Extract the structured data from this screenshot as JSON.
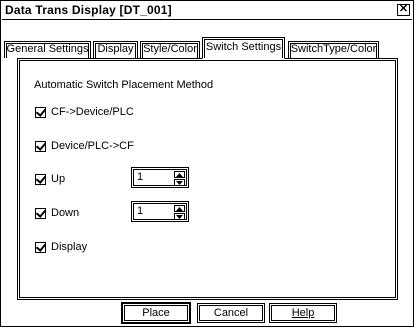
{
  "window": {
    "title": "Data Trans Display [DT_001]",
    "close_glyph": "✕"
  },
  "tabs": [
    {
      "label": "General Settings"
    },
    {
      "label": "Display"
    },
    {
      "label": "Style/Color"
    },
    {
      "label": "Switch Settings",
      "active": true
    },
    {
      "label": "SwitchType/Color"
    }
  ],
  "panel": {
    "section_label": "Automatic Switch Placement Method",
    "options": [
      {
        "label": "CF->Device/PLC",
        "checked": true
      },
      {
        "label": "Device/PLC->CF",
        "checked": true
      },
      {
        "label": "Up",
        "checked": true,
        "spin_value": "1"
      },
      {
        "label": "Down",
        "checked": true,
        "spin_value": "1"
      },
      {
        "label": "Display",
        "checked": true
      }
    ]
  },
  "buttons": {
    "place": "Place",
    "cancel": "Cancel",
    "help": "Help"
  }
}
